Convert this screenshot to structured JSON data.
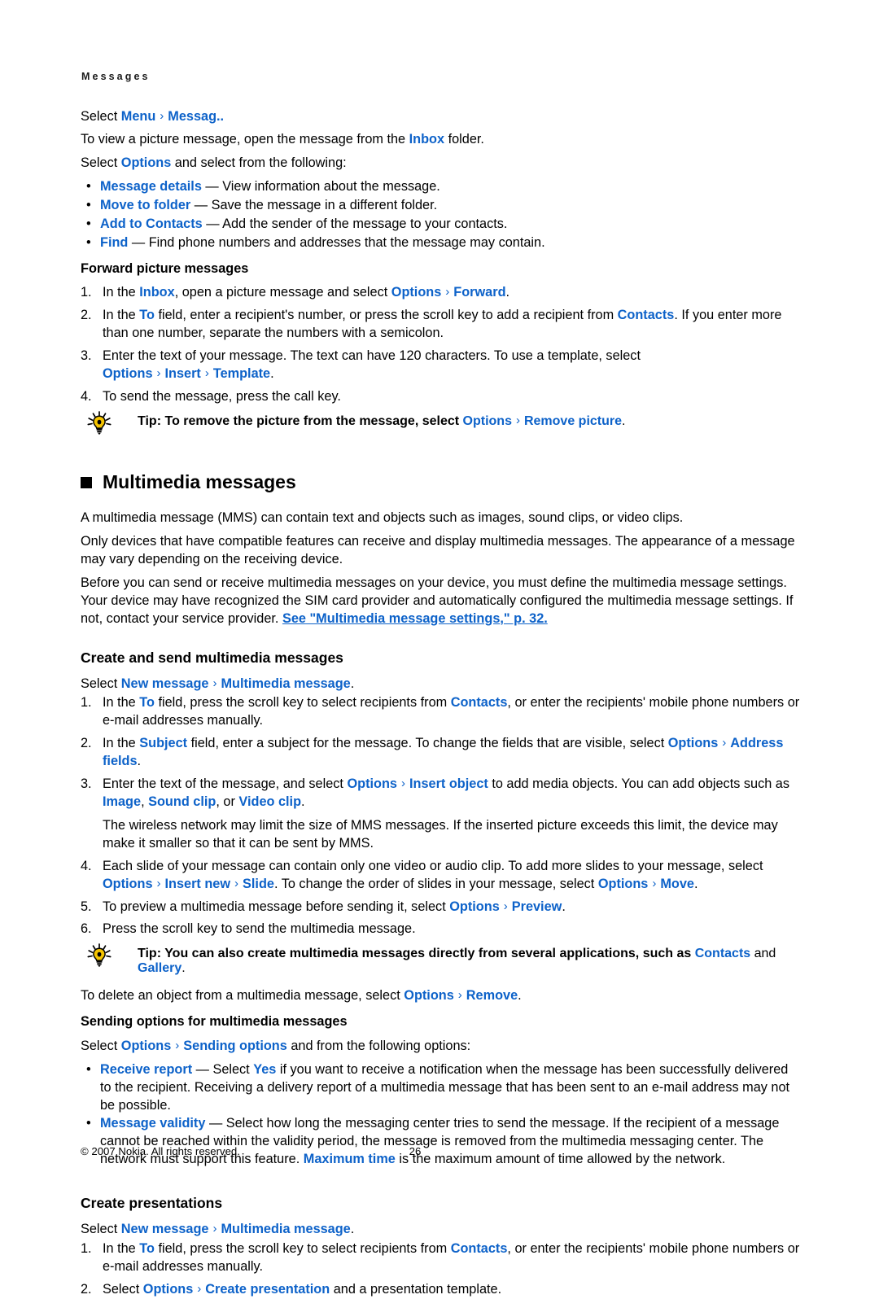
{
  "document": {
    "running_head": "Messages",
    "page_number": "26",
    "copyright": "© 2007 Nokia. All rights reserved.",
    "accent_color": "#0d62c9",
    "text_color": "#000000"
  },
  "intro": {
    "select_label": "Select ",
    "menu": "Menu",
    "messaging": "Messag..",
    "line2_a": "To view a picture message, open the message from the ",
    "line2_inbox": "Inbox",
    "line2_b": " folder.",
    "line3_a": "Select ",
    "line3_options": "Options",
    "line3_b": " and select from the following:"
  },
  "options_list": [
    {
      "term": "Message details",
      "desc": " — View information about the message."
    },
    {
      "term": "Move to folder",
      "desc": " — Save the message in a different folder."
    },
    {
      "term": "Add to Contacts",
      "desc": " — Add the sender of the message to your contacts."
    },
    {
      "term": "Find",
      "desc": " — Find phone numbers and addresses that the message may contain."
    }
  ],
  "forward": {
    "heading": "Forward picture messages",
    "s1_a": "In the ",
    "s1_inbox": "Inbox",
    "s1_b": ", open a picture message and select ",
    "s1_options": "Options",
    "s1_forward": "Forward",
    "s1_c": ".",
    "s2_a": "In the ",
    "s2_to": "To",
    "s2_b": " field, enter a recipient's number, or press the scroll key to add a recipient from ",
    "s2_contacts": "Contacts",
    "s2_c": ". If you enter more than one number, separate the numbers with a semicolon.",
    "s3_a": "Enter the text of your message. The text can have 120 characters. To use a template, select ",
    "s3_options": "Options",
    "s3_insert": "Insert",
    "s3_template": "Template",
    "s3_b": ".",
    "s4": "To send the message, press the call key.",
    "tip_a": "Tip: To remove the picture from the message, select ",
    "tip_options": "Options",
    "tip_remove": "Remove picture",
    "tip_b": "."
  },
  "multimedia": {
    "heading": "Multimedia messages",
    "p1": "A multimedia message (MMS) can contain text and objects such as images, sound clips, or video clips.",
    "p2": "Only devices that have compatible features can receive and display multimedia messages. The appearance of a message may vary depending on the receiving device.",
    "p3_a": "Before you can send or receive multimedia messages on your device, you must define the multimedia message settings. Your device may have recognized the SIM card provider and automatically configured the multimedia message settings. If not, contact your service provider. ",
    "p3_link": "See \"Multimedia message settings,\" p. 32."
  },
  "create_send": {
    "heading": "Create and send multimedia messages",
    "select_a": "Select ",
    "select_new": "New message",
    "select_mm": "Multimedia message",
    "select_b": ".",
    "s1_a": "In the ",
    "s1_to": "To",
    "s1_b": " field, press the scroll key to select recipients from ",
    "s1_contacts": "Contacts",
    "s1_c": ", or enter the recipients' mobile phone numbers or e-mail addresses manually.",
    "s2_a": "In the ",
    "s2_subject": "Subject",
    "s2_b": " field, enter a subject for the message. To change the fields that are visible, select ",
    "s2_options": "Options",
    "s2_address": "Address fields",
    "s2_c": ".",
    "s3_a": "Enter the text of the message, and select ",
    "s3_options": "Options",
    "s3_insert_object": "Insert object",
    "s3_b": " to add media objects. You can add objects such as ",
    "s3_image": "Image",
    "s3_c": ", ",
    "s3_sound": "Sound clip",
    "s3_d": ", or ",
    "s3_video": "Video clip",
    "s3_e": ".",
    "s3_sub": "The wireless network may limit the size of MMS messages. If the inserted picture exceeds this limit, the device may make it smaller so that it can be sent by MMS.",
    "s4_a": "Each slide of your message can contain only one video or audio clip. To add more slides to your message, select ",
    "s4_options": "Options",
    "s4_insert_new": "Insert new",
    "s4_slide": "Slide",
    "s4_b": ". To change the order of slides in your message, select ",
    "s4_options2": "Options",
    "s4_move": "Move",
    "s4_c": ".",
    "s5_a": "To preview a multimedia message before sending it, select ",
    "s5_options": "Options",
    "s5_preview": "Preview",
    "s5_b": ".",
    "s6": "Press the scroll key to send the multimedia message.",
    "tip_a": "Tip: You can also create multimedia messages directly from several applications, such as ",
    "tip_contacts": "Contacts",
    "tip_b": " and ",
    "tip_gallery": "Gallery",
    "tip_c": ".",
    "delete_a": "To delete an object from a multimedia message, select ",
    "delete_options": "Options",
    "delete_remove": "Remove",
    "delete_b": "."
  },
  "sending_options": {
    "heading": "Sending options for multimedia messages",
    "select_a": "Select ",
    "select_options": "Options",
    "select_sending": "Sending options",
    "select_b": " and from the following options:",
    "i1_term": "Receive report",
    "i1_a": " — Select ",
    "i1_yes": "Yes",
    "i1_b": " if you want to receive a notification when the message has been successfully delivered to the recipient. Receiving a delivery report of a multimedia message that has been sent to an e-mail address may not be possible.",
    "i2_term": "Message validity",
    "i2_a": " — Select how long the messaging center tries to send the message. If the recipient of a message cannot be reached within the validity period, the message is removed from the multimedia messaging center. The network must support this feature. ",
    "i2_max": "Maximum time",
    "i2_b": " is the maximum amount of time allowed by the network."
  },
  "presentations": {
    "heading": "Create presentations",
    "select_a": "Select ",
    "select_new": "New message",
    "select_mm": "Multimedia message",
    "select_b": ".",
    "s1_a": "In the ",
    "s1_to": "To",
    "s1_b": " field, press the scroll key to select recipients from ",
    "s1_contacts": "Contacts",
    "s1_c": ", or enter the recipients' mobile phone numbers or e-mail addresses manually.",
    "s2_a": "Select ",
    "s2_options": "Options",
    "s2_create": "Create presentation",
    "s2_b": " and a presentation template."
  },
  "icons": {
    "tip_bulb": "lightbulb-icon",
    "chevron": "›",
    "bullet": "•",
    "square": "■"
  }
}
